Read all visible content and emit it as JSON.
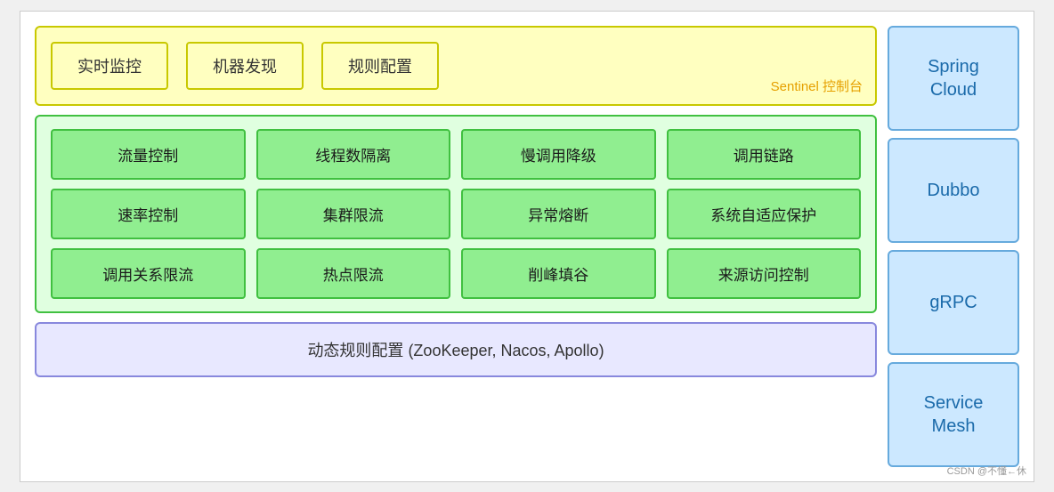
{
  "sentinel": {
    "boxes": [
      "实时监控",
      "机器发现",
      "规则配置"
    ],
    "label": "Sentinel 控制台"
  },
  "features": {
    "rows": [
      [
        "流量控制",
        "线程数隔离",
        "慢调用降级",
        "调用链路"
      ],
      [
        "速率控制",
        "集群限流",
        "异常熔断",
        "系统自适应保护"
      ],
      [
        "调用关系限流",
        "热点限流",
        "削峰填谷",
        "来源访问控制"
      ]
    ]
  },
  "dynamic": {
    "label": "动态规则配置 (ZooKeeper, Nacos, Apollo)"
  },
  "sidebar": {
    "items": [
      "Spring\nCloud",
      "Dubbo",
      "gRPC",
      "Service\nMesh"
    ]
  },
  "watermark": "CSDN @不懂←休"
}
